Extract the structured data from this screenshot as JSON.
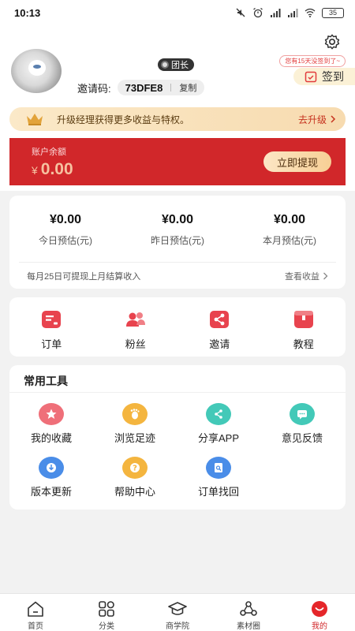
{
  "status_bar": {
    "time": "10:13",
    "battery": "35"
  },
  "profile": {
    "role_badge": "团长",
    "invite_label": "邀请码:",
    "invite_code": "73DFE8",
    "copy_label": "复制",
    "sign_tip": "您有15天没签到了~",
    "sign_label": "签到"
  },
  "upgrade": {
    "text": "升级经理获得更多收益与特权。",
    "link": "去升级"
  },
  "balance": {
    "label": "账户余额",
    "currency": "¥",
    "amount": "0.00",
    "withdraw_label": "立即提现"
  },
  "earnings": {
    "items": [
      {
        "value": "¥0.00",
        "label": "今日预估(元)"
      },
      {
        "value": "¥0.00",
        "label": "昨日预估(元)"
      },
      {
        "value": "¥0.00",
        "label": "本月预估(元)"
      }
    ],
    "note": "每月25日可提现上月结算收入",
    "link": "查看收益"
  },
  "quick": [
    {
      "label": "订单",
      "icon": "order-icon",
      "color": "#e8434e"
    },
    {
      "label": "粉丝",
      "icon": "fans-icon",
      "color": "#e8434e"
    },
    {
      "label": "邀请",
      "icon": "share-icon",
      "color": "#e8434e"
    },
    {
      "label": "教程",
      "icon": "tutorial-icon",
      "color": "#e8434e"
    }
  ],
  "tools": {
    "title": "常用工具",
    "items": [
      {
        "label": "我的收藏",
        "icon": "star-icon",
        "color": "#ef6f79"
      },
      {
        "label": "浏览足迹",
        "icon": "footprint-icon",
        "color": "#f4b53f"
      },
      {
        "label": "分享APP",
        "icon": "share-icon",
        "color": "#43c9b8"
      },
      {
        "label": "意见反馈",
        "icon": "feedback-icon",
        "color": "#43c9b8"
      },
      {
        "label": "版本更新",
        "icon": "download-icon",
        "color": "#4a8de8"
      },
      {
        "label": "帮助中心",
        "icon": "help-icon",
        "color": "#f4b53f"
      },
      {
        "label": "订单找回",
        "icon": "order-search-icon",
        "color": "#4a8de8"
      }
    ]
  },
  "tabbar": [
    {
      "label": "首页",
      "icon": "home-icon"
    },
    {
      "label": "分类",
      "icon": "category-icon"
    },
    {
      "label": "商学院",
      "icon": "school-icon"
    },
    {
      "label": "素材圈",
      "icon": "material-icon"
    },
    {
      "label": "我的",
      "icon": "profile-icon",
      "active": true
    }
  ]
}
